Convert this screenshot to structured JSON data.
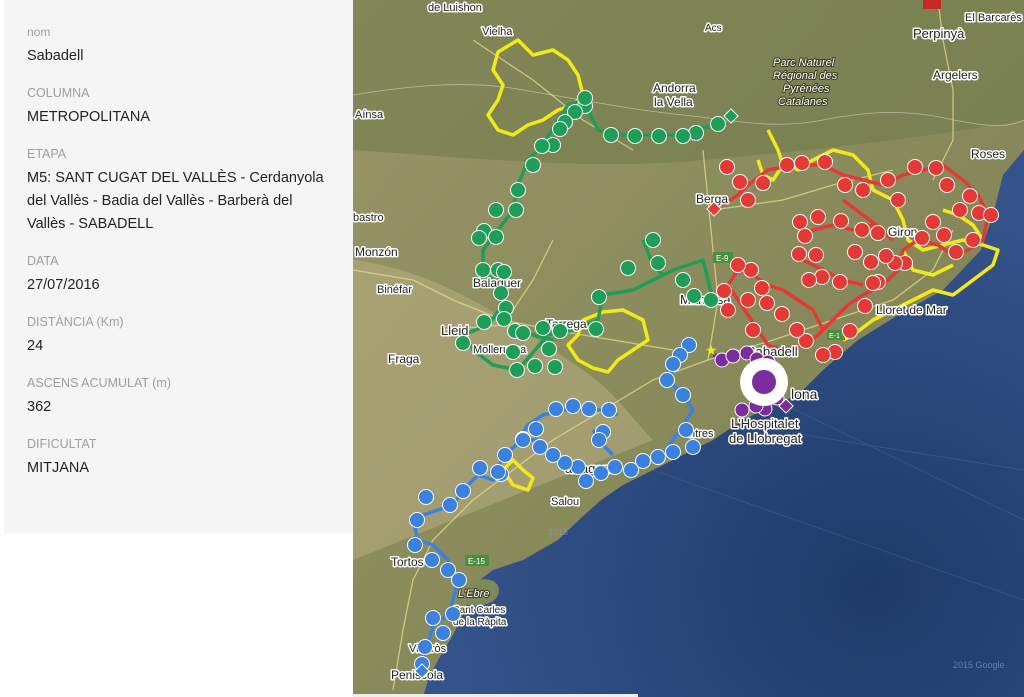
{
  "fields": [
    {
      "key": "nom",
      "label": "nom",
      "value": "Sabadell"
    },
    {
      "key": "columna",
      "label": "COLUMNA",
      "value": "METROPOLITANA"
    },
    {
      "key": "etapa",
      "label": "ETAPA",
      "value": "M5: SANT CUGAT DEL VALLÈS - Cerdanyola del Vallès - Badia del Vallès - Barberà del Vallès - SABADELL"
    },
    {
      "key": "data",
      "label": "DATA",
      "value": "27/07/2016"
    },
    {
      "key": "distancia",
      "label": "DISTÀNCIA (Km)",
      "value": "24"
    },
    {
      "key": "ascens",
      "label": "ASCENS ACUMULAT (m)",
      "value": "362"
    },
    {
      "key": "dificultat",
      "label": "DIFICULTAT",
      "value": "MITJANA"
    }
  ],
  "map": {
    "places": {
      "luishon": "de Luishon",
      "vielha": "Vielha",
      "acs": "Acs",
      "perpinya": "Perpinyà",
      "el_barcares": "El Barcarès",
      "argelers": "Argelers",
      "roses": "Roses",
      "andorra": "Andorra",
      "la_vella": "la Vella",
      "parc_line1": "Parc Naturel",
      "parc_line2": "Régional des",
      "parc_line3": "Pyrénées",
      "parc_line4": "Catalanes",
      "ainsa": "Aínsa",
      "berga": "Berga",
      "girona": "Giron",
      "barbastro": "bastro",
      "monzon": "Monzón",
      "binefar": "Binéfar",
      "balaguer": "Balaguer",
      "lleida": "Lleid",
      "tarrega": "Tarrega",
      "manresa": "Manresa",
      "lloret": "Lloret de Mar",
      "mollerussa": "Mollerussa",
      "fraga": "Fraga",
      "sabadell": "Sabadell",
      "barcelona": "lona",
      "hospitalet_1": "L'Hospitalet",
      "hospitalet_2": "de Llobregat",
      "vilanova": "ntres",
      "tarragona": "arragona",
      "salou": "Salou",
      "tortosa": "Tortos",
      "ebre": "L'Ebre",
      "sant_carles_1": "Sant Carles",
      "sant_carles_2": "de la Ràpita",
      "vinaros": "Vinaròs",
      "peniscola": "Peniscola"
    },
    "roads": {
      "e9": "E-9",
      "e15": "E-15",
      "e15b": "E-1"
    },
    "watermarks": {
      "year1": "2015",
      "year2": "2015 Google"
    },
    "colors": {
      "land": "#c7c19b",
      "sea": "#2d4a7e",
      "deep_sea": "#233d6b",
      "yellow_route": "#f2e81a",
      "green_route": "#1e9e58",
      "red_route": "#e53935",
      "blue_route": "#3b82e0",
      "purple_route": "#7b2c9e"
    },
    "current_marker": "purple-target-marker"
  }
}
